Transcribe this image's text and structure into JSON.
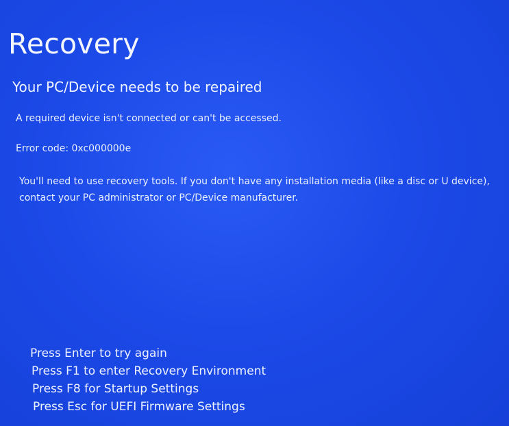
{
  "screen": {
    "title": "Recovery",
    "subtitle": "Your PC/Device needs to be repaired",
    "description": "A required device isn't connected or can't be accessed.",
    "error_code": "Error code: 0xc000000e",
    "advice": "You'll need to use recovery tools. If you don't have any installation media (like a disc or U device), contact your PC administrator or PC/Device manufacturer.",
    "options": [
      "Press Enter to try again",
      "Press F1 to enter Recovery Environment",
      "Press F8 for Startup Settings",
      "Press Esc for UEFI Firmware Settings"
    ],
    "colors": {
      "background": "#1a47e6",
      "text": "#eef2ff"
    }
  }
}
